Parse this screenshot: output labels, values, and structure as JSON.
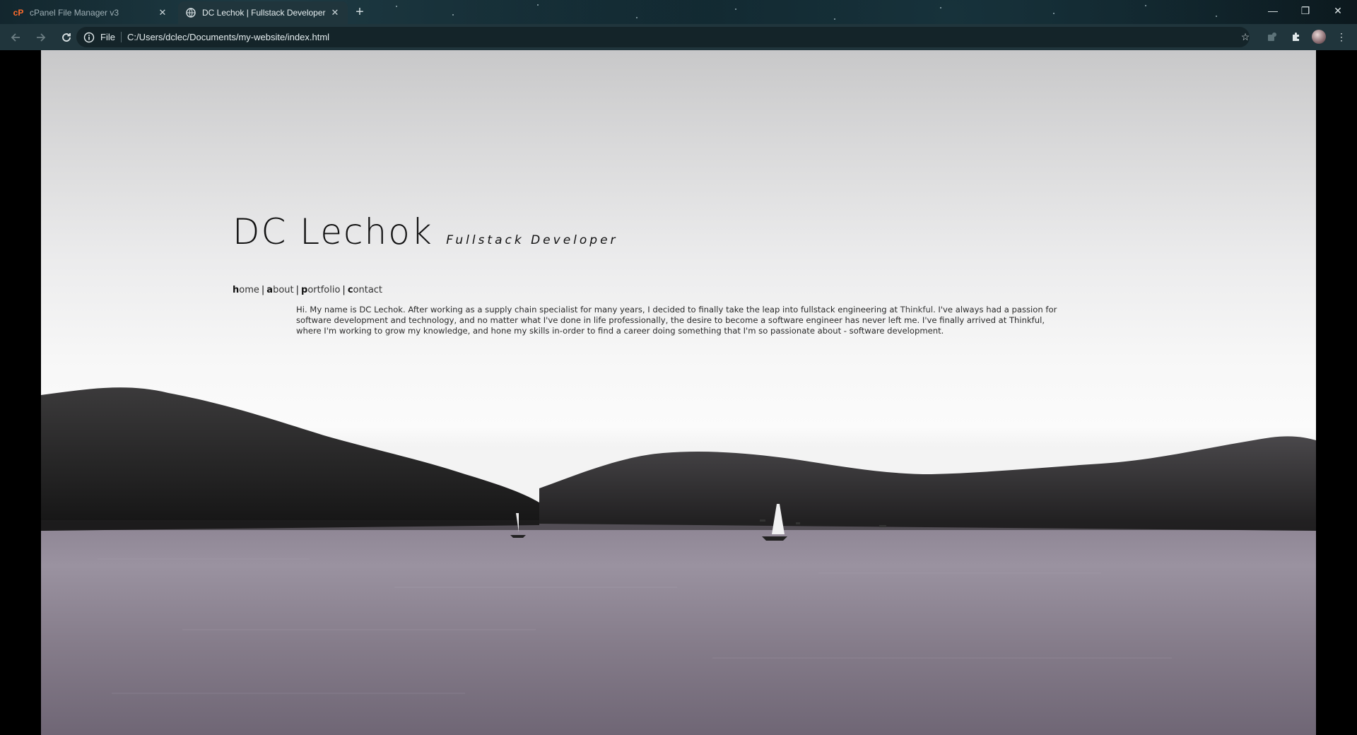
{
  "browser": {
    "tabs": [
      {
        "title": "cPanel File Manager v3",
        "active": false,
        "icon": "cpanel-icon"
      },
      {
        "title": "DC Lechok | Fullstack Developer",
        "active": true,
        "icon": "globe-icon"
      }
    ],
    "address": {
      "scheme": "File",
      "url": "C:/Users/dclec/Documents/my-website/index.html"
    }
  },
  "site": {
    "name": "DC Lechok",
    "tagline": "Fullstack Developer",
    "nav": [
      {
        "first": "h",
        "rest": "ome"
      },
      {
        "first": "a",
        "rest": "bout"
      },
      {
        "first": "p",
        "rest": "ortfolio"
      },
      {
        "first": "c",
        "rest": "ontact"
      }
    ],
    "separator": "|",
    "bio": {
      "before": "Hi. My name is DC Lechok. After working as a supply chain specialist for many years, I decided to finally take the leap into fullstack engineering at ",
      "link": "Thinkful",
      "after": ". I've always had a passion for software development and technology, and no matter what I've done in life professionally, the desire to become a software engineer has never left me. I've finally arrived at Thinkful, where I'm working to grow my knowledge, and hone my skills in-order to find a career doing something that I'm so passionate about - software development."
    }
  },
  "colors": {
    "chrome": "#20353c",
    "text": "#111111"
  }
}
